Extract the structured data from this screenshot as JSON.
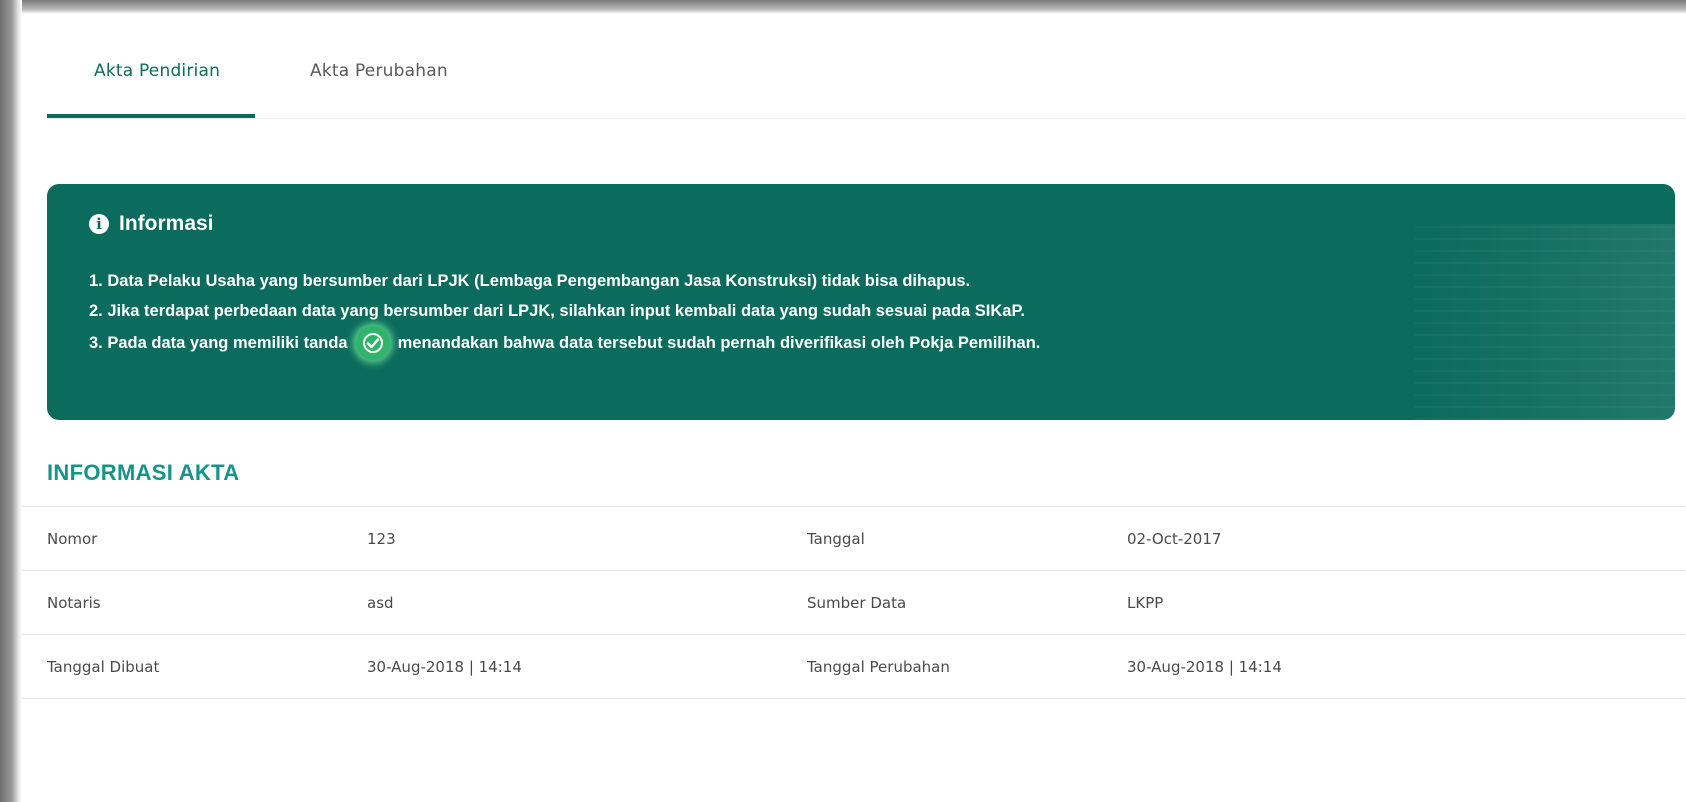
{
  "tabs": [
    {
      "label": "Akta Pendirian",
      "active": true
    },
    {
      "label": "Akta Perubahan",
      "active": false
    }
  ],
  "info": {
    "title": "Informasi",
    "items": [
      "1. Data Pelaku Usaha yang bersumber dari LPJK (Lembaga Pengembangan Jasa Konstruksi) tidak bisa dihapus.",
      "2. Jika terdapat perbedaan data yang bersumber dari LPJK, silahkan input kembali data yang sudah sesuai pada SIKaP.",
      "3. Pada data yang memiliki tanda"
    ],
    "item3_suffix": "menandakan bahwa data tersebut sudah pernah diverifikasi oleh Pokja Pemilihan.",
    "badge_icon": "verified-check-icon",
    "colors": {
      "background": "#0b6b5c",
      "badge": "#2fb56a"
    }
  },
  "section": {
    "title": "INFORMASI AKTA"
  },
  "table": {
    "rows": [
      {
        "label1": "Nomor",
        "value1": "123",
        "label2": "Tanggal",
        "value2": "02-Oct-2017"
      },
      {
        "label1": "Notaris",
        "value1": "asd",
        "label2": "Sumber Data",
        "value2": "LKPP"
      },
      {
        "label1": "Tanggal Dibuat",
        "value1": "30-Aug-2018 | 14:14",
        "label2": "Tanggal Perubahan",
        "value2": "30-Aug-2018 | 14:14"
      }
    ]
  },
  "colors": {
    "accent": "#0b6b5c",
    "section_title": "#159488"
  }
}
